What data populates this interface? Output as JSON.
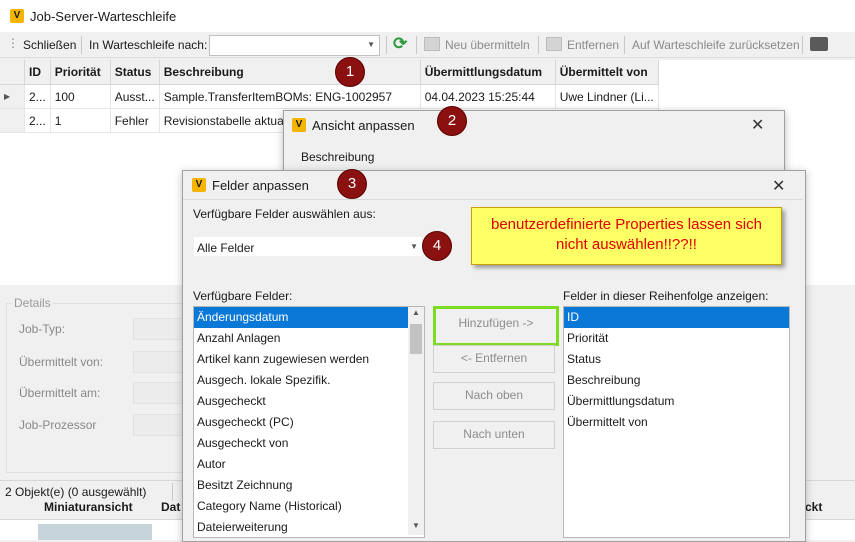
{
  "window": {
    "title": "Job-Server-Warteschleife",
    "icon": "vault-v-icon"
  },
  "toolbar": {
    "close_label": "Schließen",
    "queue_label": "In Warteschleife nach:",
    "queue_value": "",
    "resubmit_label": "Neu übermitteln",
    "remove_label": "Entfernen",
    "reset_label": "Auf Warteschleife zurücksetzen"
  },
  "grid": {
    "columns": [
      "ID",
      "Priorität",
      "Status",
      "Beschreibung",
      "Übermittlungsdatum",
      "Übermittelt von"
    ],
    "rows": [
      [
        "2...",
        "100",
        "Ausst...",
        "Sample.TransferItemBOMs: ENG-1002957",
        "04.04.2023 15:25:44",
        "Uwe Lindner (Li..."
      ],
      [
        "2...",
        "1",
        "Fehler",
        "Revisionstabelle aktuali",
        "",
        ""
      ]
    ]
  },
  "details": {
    "title": "Details",
    "labels": [
      "Job-Typ:",
      "Übermittelt von:",
      "Übermittelt am:",
      "Job-Prozessor"
    ]
  },
  "status_bar": {
    "text": "2 Objekt(e) (0 ausgewählt)"
  },
  "bottom_grid": {
    "col1": "Miniaturansicht",
    "col2": "Dat",
    "col3": "ckt"
  },
  "ansicht_dialog": {
    "title": "Ansicht anpassen",
    "section": "Beschreibung"
  },
  "felder_dialog": {
    "title": "Felder anpassen",
    "source_label": "Verfügbare Felder auswählen aus:",
    "source_value": "Alle Felder",
    "available_label": "Verfügbare Felder:",
    "available": [
      "Änderungsdatum",
      "Anzahl Anlagen",
      "Artikel kann zugewiesen werden",
      "Ausgech. lokale Spezifik.",
      "Ausgecheckt",
      "Ausgecheckt (PC)",
      "Ausgecheckt von",
      "Autor",
      "Besitzt Zeichnung",
      "Category Name (Historical)",
      "Dateierweiterung"
    ],
    "display_label": "Felder in dieser Reihenfolge anzeigen:",
    "display": [
      "ID",
      "Priorität",
      "Status",
      "Beschreibung",
      "Übermittlungsdatum",
      "Übermittelt von"
    ],
    "add_label": "Hinzufügen ->",
    "remove_label": "<- Entfernen",
    "up_label": "Nach oben",
    "down_label": "Nach unten"
  },
  "callout": {
    "text": "benutzerdefinierte Properties lassen sich nicht auswählen!!??!!"
  },
  "markers": [
    "1",
    "2",
    "3",
    "4"
  ],
  "colors": {
    "selection": "#0a78d7",
    "marker": "#8b1010",
    "callout_bg": "#ffff66",
    "callout_text": "#e00000",
    "highlight": "#7ddc1f"
  }
}
